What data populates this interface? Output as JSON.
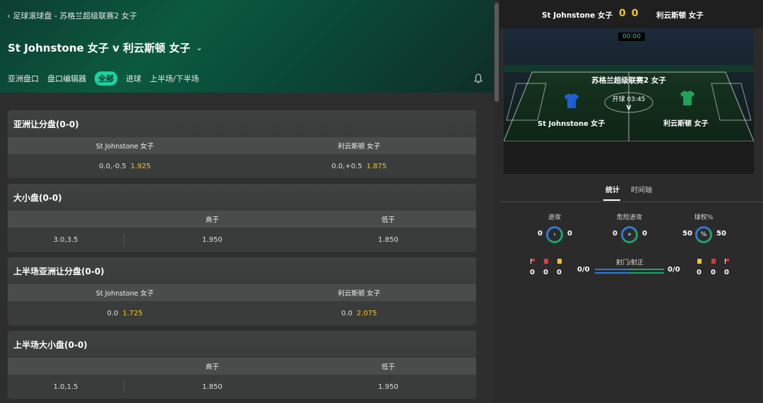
{
  "breadcrumb": {
    "text": "足球滚球盘 - 苏格兰超级联赛2 女子"
  },
  "match": {
    "title": "St Johnstone 女子 v 利云斯顿 女子"
  },
  "tabs": [
    {
      "label": "亚洲盘口",
      "active": false
    },
    {
      "label": "盘口编辑器",
      "active": false
    },
    {
      "label": "全部",
      "active": true
    },
    {
      "label": "进球",
      "active": false
    },
    {
      "label": "上半场/下半场",
      "active": false
    }
  ],
  "markets": [
    {
      "title": "亚洲让分盘(0-0)",
      "type": "two",
      "cols": [
        "St Johnstone 女子",
        "利云斯顿 女子"
      ],
      "line": [
        "0.0,-0.5",
        "0.0,+0.5"
      ],
      "odds": [
        "1.925",
        "1.875"
      ]
    },
    {
      "title": "大小盘(0-0)",
      "type": "three",
      "cols": [
        "高于",
        "低于"
      ],
      "line": "3.0,3.5",
      "odds": [
        "1.950",
        "1.850"
      ]
    },
    {
      "title": "上半场亚洲让分盘(0-0)",
      "type": "two",
      "cols": [
        "St Johnstone 女子",
        "利云斯顿 女子"
      ],
      "line": [
        "0.0",
        "0.0"
      ],
      "odds": [
        "1.725",
        "2.075"
      ]
    },
    {
      "title": "上半场大小盘(0-0)",
      "type": "three",
      "cols": [
        "高于",
        "低于"
      ],
      "line": "1.0,1.5",
      "odds": [
        "1.850",
        "1.950"
      ]
    }
  ],
  "scoreboard": {
    "home": "St Johnstone 女子",
    "away": "利云斯顿 女子",
    "home_score": "0",
    "away_score": "0"
  },
  "pitch": {
    "clock": "00:00",
    "league": "苏格兰超级联赛2 女子",
    "kickoff": "开球 03:45",
    "versus": "V",
    "home": "St Johnstone 女子",
    "away": "利云斯顿 女子",
    "home_color": "#1f5fd6",
    "away_color": "#1ea35a"
  },
  "stat_tabs": [
    {
      "label": "统计",
      "active": true
    },
    {
      "label": "时间轴",
      "active": false
    }
  ],
  "gauges": [
    {
      "label": "进攻",
      "home": "0",
      "away": "0",
      "icon": "›"
    },
    {
      "label": "危险进攻",
      "home": "0",
      "away": "0",
      "icon": "»"
    },
    {
      "label": "球权%",
      "home": "50",
      "away": "50",
      "icon": "%"
    }
  ],
  "card_stats": {
    "home": {
      "corners": "0",
      "red": "0",
      "yellow": "0"
    },
    "away": {
      "yellow": "0",
      "red": "0",
      "corners": "0"
    },
    "shots_label": "射门/射正",
    "shots_home": "0/0",
    "shots_away": "0/0"
  },
  "colors": {
    "accent": "#19d3a0",
    "odds": "#f5c518",
    "home": "#2f7bd6",
    "away": "#1fa36b"
  }
}
